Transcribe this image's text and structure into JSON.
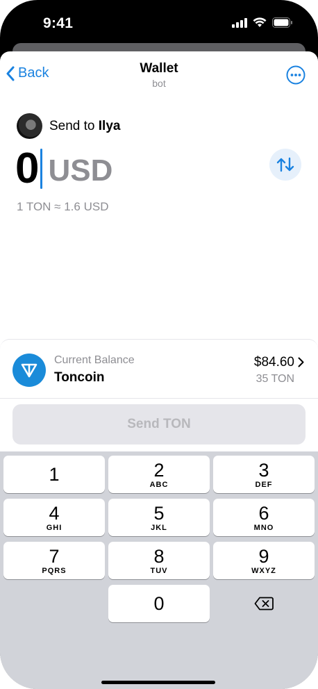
{
  "status": {
    "time": "9:41"
  },
  "nav": {
    "back_label": "Back",
    "title": "Wallet",
    "subtitle": "bot"
  },
  "recipient": {
    "prefix": "Send to",
    "name": "Ilya"
  },
  "amount": {
    "value": "0",
    "currency": "USD",
    "rate": "1 TON ≈ 1.6 USD"
  },
  "balance": {
    "label": "Current Balance",
    "token": "Toncoin",
    "usd": "$84.60",
    "ton": "35 TON"
  },
  "send_button": {
    "label": "Send TON",
    "enabled": false
  },
  "keypad": {
    "keys": [
      {
        "num": "1",
        "letters": ""
      },
      {
        "num": "2",
        "letters": "ABC"
      },
      {
        "num": "3",
        "letters": "DEF"
      },
      {
        "num": "4",
        "letters": "GHI"
      },
      {
        "num": "5",
        "letters": "JKL"
      },
      {
        "num": "6",
        "letters": "MNO"
      },
      {
        "num": "7",
        "letters": "PQRS"
      },
      {
        "num": "8",
        "letters": "TUV"
      },
      {
        "num": "9",
        "letters": "WXYZ"
      },
      {
        "num": "0",
        "letters": ""
      }
    ]
  },
  "colors": {
    "accent": "#1a82e0",
    "ton_blue": "#1a8bd9"
  }
}
